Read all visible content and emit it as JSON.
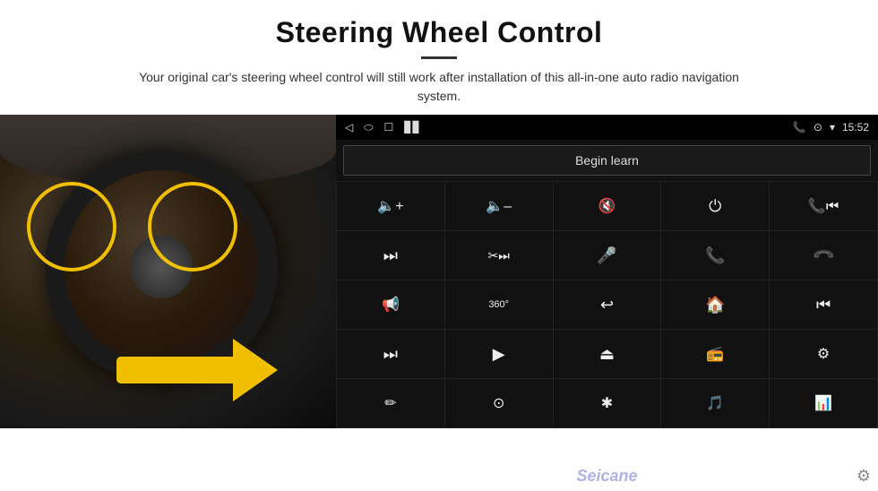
{
  "header": {
    "title": "Steering Wheel Control",
    "subtitle": "Your original car's steering wheel control will still work after installation of this all-in-one auto radio navigation system."
  },
  "status_bar": {
    "back_icon": "◁",
    "home_oval": "⬭",
    "square_icon": "☐",
    "signal_icon": "▊▊",
    "phone_icon": "📞",
    "location_icon": "⊙",
    "wifi_icon": "▾",
    "time": "15:52"
  },
  "begin_learn": {
    "label": "Begin learn"
  },
  "controls": [
    {
      "icon": "🔊+",
      "label": "vol-up"
    },
    {
      "icon": "🔊–",
      "label": "vol-down"
    },
    {
      "icon": "🔇",
      "label": "mute"
    },
    {
      "icon": "⏻",
      "label": "power"
    },
    {
      "icon": "⏮",
      "label": "prev-track"
    },
    {
      "icon": "⏭",
      "label": "next"
    },
    {
      "icon": "✂⏭",
      "label": "fast-forward-2"
    },
    {
      "icon": "🎤",
      "label": "mic"
    },
    {
      "icon": "📞",
      "label": "call"
    },
    {
      "icon": "↩",
      "label": "hang-up"
    },
    {
      "icon": "📢",
      "label": "horn"
    },
    {
      "icon": "🔄",
      "label": "360"
    },
    {
      "icon": "↩",
      "label": "back"
    },
    {
      "icon": "🏠",
      "label": "home"
    },
    {
      "icon": "⏮⏮",
      "label": "rewind"
    },
    {
      "icon": "⏭⏭",
      "label": "skip"
    },
    {
      "icon": "⮕",
      "label": "navigate"
    },
    {
      "icon": "⏏",
      "label": "eject"
    },
    {
      "icon": "📻",
      "label": "radio"
    },
    {
      "icon": "⚙",
      "label": "settings-ctrl"
    },
    {
      "icon": "✏",
      "label": "pen"
    },
    {
      "icon": "⊙",
      "label": "360-2"
    },
    {
      "icon": "✱",
      "label": "bluetooth"
    },
    {
      "icon": "🎵",
      "label": "music"
    },
    {
      "icon": "📊",
      "label": "equalizer"
    }
  ],
  "watermark": {
    "text": "Seicane"
  },
  "gear": {
    "icon": "⚙"
  }
}
